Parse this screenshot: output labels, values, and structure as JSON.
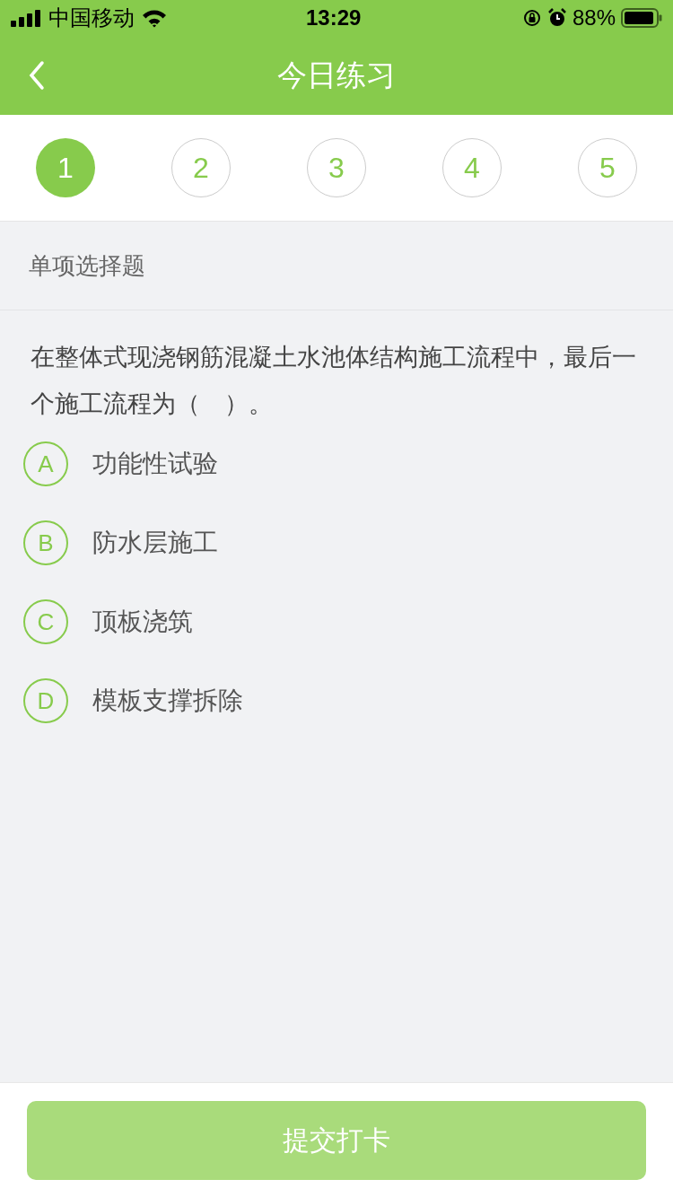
{
  "status_bar": {
    "carrier": "中国移动",
    "time": "13:29",
    "battery": "88%"
  },
  "nav": {
    "title": "今日练习"
  },
  "steps": [
    {
      "label": "1",
      "selected": true
    },
    {
      "label": "2",
      "selected": false
    },
    {
      "label": "3",
      "selected": false
    },
    {
      "label": "4",
      "selected": false
    },
    {
      "label": "5",
      "selected": false
    }
  ],
  "section": {
    "label": "单项选择题"
  },
  "question": "在整体式现浇钢筋混凝土水池体结构施工流程中，最后一个施工流程为（　）。",
  "options": [
    {
      "letter": "A",
      "text": "功能性试验",
      "selected": false
    },
    {
      "letter": "B",
      "text": "防水层施工",
      "selected": false
    },
    {
      "letter": "C",
      "text": "顶板浇筑",
      "selected": false
    },
    {
      "letter": "D",
      "text": "模板支撑拆除",
      "selected": false
    }
  ],
  "submit": {
    "label": "提交打卡",
    "disabled": true
  }
}
